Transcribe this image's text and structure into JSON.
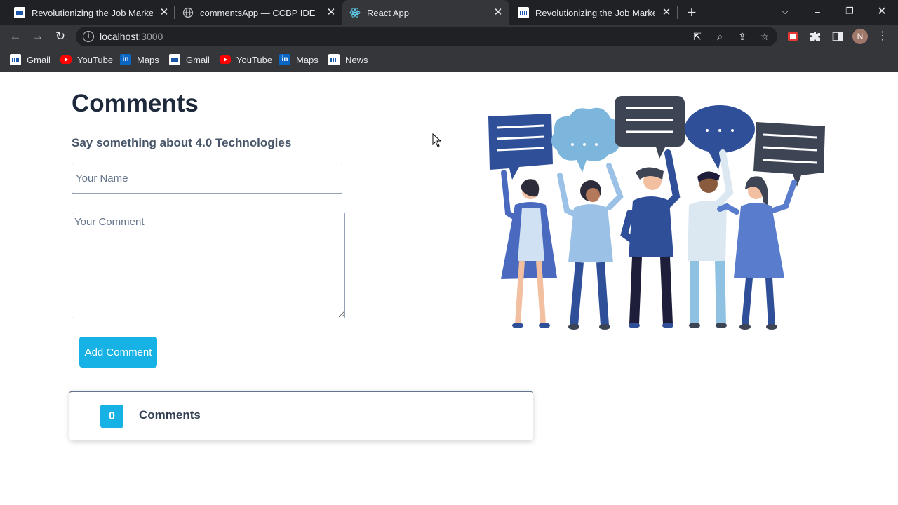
{
  "browser": {
    "tabs": [
      {
        "title": "Revolutionizing the Job Market |",
        "icon": "nxt-wave-favicon",
        "active": false
      },
      {
        "title": "commentsApp — CCBP IDE",
        "icon": "globe-icon",
        "active": false
      },
      {
        "title": "React App",
        "icon": "react-icon",
        "active": true
      },
      {
        "title": "Revolutionizing the Job Market |",
        "icon": "nxt-wave-favicon",
        "active": false
      }
    ],
    "url_host": "localhost",
    "url_port": ":3000",
    "profile_initial": "N",
    "bookmarks": [
      {
        "label": "Gmail",
        "icon": "nxt-wave-favicon"
      },
      {
        "label": "YouTube",
        "icon": "youtube-icon"
      },
      {
        "label": "Maps",
        "icon": "linkedin-icon"
      },
      {
        "label": "Gmail",
        "icon": "nxt-wave-favicon"
      },
      {
        "label": "YouTube",
        "icon": "youtube-icon"
      },
      {
        "label": "Maps",
        "icon": "linkedin-icon"
      },
      {
        "label": "News",
        "icon": "nxt-wave-favicon"
      }
    ]
  },
  "page": {
    "heading": "Comments",
    "subtitle": "Say something about 4.0 Technologies",
    "name_placeholder": "Your Name",
    "comment_placeholder": "Your Comment",
    "add_button": "Add Comment",
    "comment_count": "0",
    "comments_label": "Comments"
  },
  "colors": {
    "accent": "#16b2e6",
    "heading": "#1e293b",
    "chrome_dark": "#202124",
    "chrome_mid": "#35363a"
  }
}
